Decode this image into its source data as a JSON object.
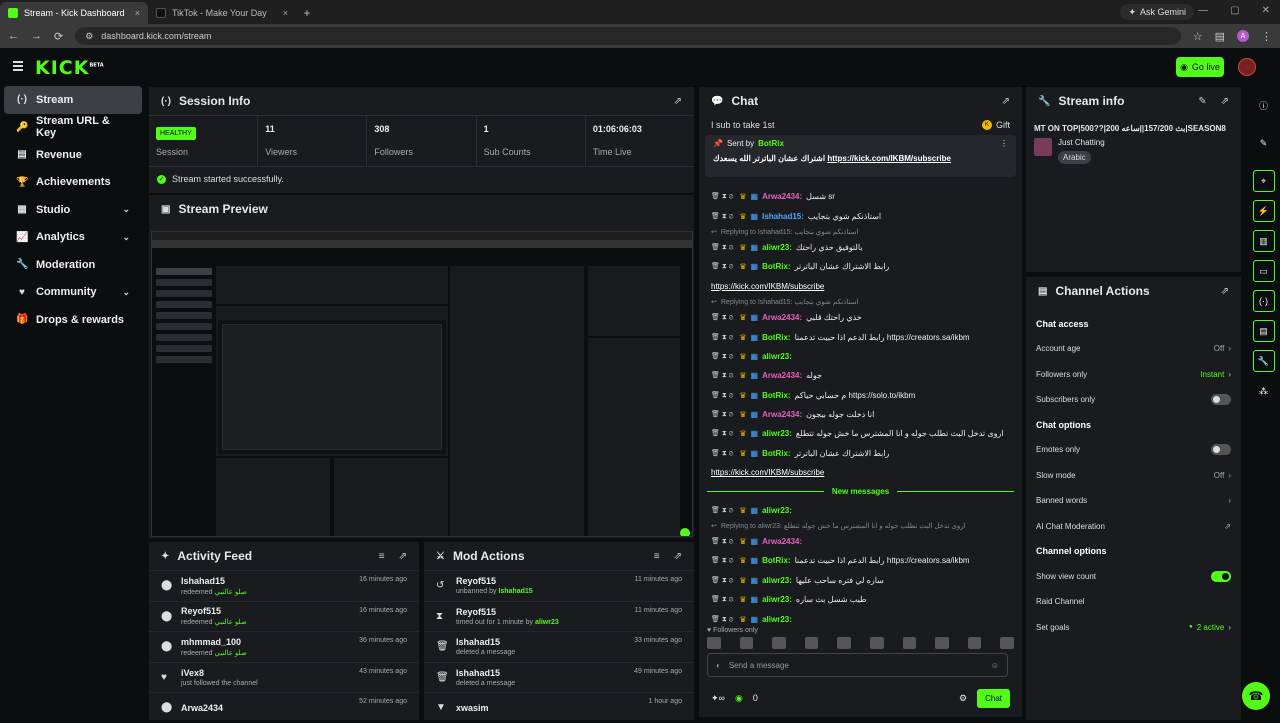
{
  "browser": {
    "tabs": [
      {
        "title": "Stream - Kick Dashboard"
      },
      {
        "title": "TikTok - Make Your Day"
      }
    ],
    "gemini": "Ask Gemini",
    "url": "dashboard.kick.com/stream",
    "profile_initial": "A"
  },
  "header": {
    "logo": "KICK",
    "logo_beta": "BETA",
    "go_live": "Go live"
  },
  "sidebar": {
    "items": [
      {
        "label": "Stream",
        "icon": "(·)"
      },
      {
        "label": "Stream URL & Key",
        "icon": "🔑"
      },
      {
        "label": "Revenue",
        "icon": "▤"
      },
      {
        "label": "Achievements",
        "icon": "🏆"
      },
      {
        "label": "Studio",
        "icon": "▦"
      },
      {
        "label": "Analytics",
        "icon": "📈"
      },
      {
        "label": "Moderation",
        "icon": "🔧"
      },
      {
        "label": "Community",
        "icon": "♥"
      },
      {
        "label": "Drops & rewards",
        "icon": "🎁"
      }
    ]
  },
  "session": {
    "title": "Session Info",
    "stats": [
      {
        "value": "HEALTHY",
        "label": "Session"
      },
      {
        "value": "11",
        "label": "Viewers"
      },
      {
        "value": "308",
        "label": "Followers"
      },
      {
        "value": "1",
        "label": "Sub Counts"
      },
      {
        "value": "01:06:06:03",
        "label": "Time Live"
      }
    ],
    "success": "Stream started successfully."
  },
  "preview": {
    "title": "Stream Preview"
  },
  "activity": {
    "title": "Activity Feed",
    "items": [
      {
        "name": "Ishahad15",
        "sub": "redeemed",
        "reward": "صلو عالنبي",
        "time": "16 minutes ago"
      },
      {
        "name": "Reyof515",
        "sub": "redeemed",
        "reward": "صلو عالنبي",
        "time": "16 minutes ago"
      },
      {
        "name": "mhmmad_100",
        "sub": "redeemed",
        "reward": "صلو عالنبي",
        "time": "36 minutes ago"
      },
      {
        "name": "iVex8",
        "sub": "just followed the channel",
        "reward": "",
        "time": "43 minutes ago"
      },
      {
        "name": "Arwa2434",
        "sub": "",
        "reward": "",
        "time": "52 minutes ago"
      }
    ]
  },
  "mod": {
    "title": "Mod Actions",
    "items": [
      {
        "icon": "↺",
        "name": "Reyof515",
        "sub": "unbanned by",
        "by": "Ishahad15",
        "time": "11 minutes ago"
      },
      {
        "icon": "⧗",
        "name": "Reyof515",
        "sub": "timed out for 1 minute by",
        "by": "aliwr23",
        "time": "11 minutes ago"
      },
      {
        "icon": "🗑",
        "name": "Ishahad15",
        "sub": "deleted a message",
        "by": "",
        "time": "33 minutes ago"
      },
      {
        "icon": "🗑",
        "name": "Ishahad15",
        "sub": "deleted a message",
        "by": "",
        "time": "49 minutes ago"
      },
      {
        "icon": "▼",
        "name": "xwasim",
        "sub": "",
        "by": "",
        "time": "1 hour ago"
      }
    ]
  },
  "chat": {
    "title": "Chat",
    "banner": "I sub to take 1st",
    "gift": "Gift",
    "pinned_sent_by": "Sent by",
    "pinned_user": "BotRix",
    "pinned_text": "اشتراك عشان الباترتر الله يسعدك",
    "pinned_link": "https://kick.com/IKBM/subscribe",
    "new_messages": "New messages",
    "followers_only": "Followers only",
    "placeholder": "Send a message",
    "count": "0",
    "send": "Chat",
    "lines": [
      {
        "type": "msg",
        "user": "Arwa2434:",
        "color": "pink",
        "text": "شسل sr"
      },
      {
        "type": "msg",
        "user": "Ishahad15:",
        "color": "blue",
        "text": "استاذنكم شوي بتجايب"
      },
      {
        "type": "reply",
        "text": "Replying to Ishahad15: استاذنكم شوي بتجايب"
      },
      {
        "type": "msg",
        "user": "aliwr23:",
        "color": "green",
        "text": "بالتوفيق حذي راحتك"
      },
      {
        "type": "msg",
        "user": "BotRix:",
        "color": "green",
        "text": "رابط الاشتراك عشان الباترتر"
      },
      {
        "type": "cont",
        "text": "https://kick.com/IKBM/subscribe"
      },
      {
        "type": "reply",
        "text": "Replying to Ishahad15: استاذنكم شوي بتجايب"
      },
      {
        "type": "msg",
        "user": "Arwa2434:",
        "color": "pink",
        "text": "خذي راحتك قلبي"
      },
      {
        "type": "msg",
        "user": "BotRix:",
        "color": "green",
        "text": "رابط الدعم اذا حبيت تدعمنا https://creators.sa/ikbm"
      },
      {
        "type": "msg",
        "user": "aliwr23:",
        "color": "green",
        "text": ""
      },
      {
        "type": "msg",
        "user": "Arwa2434:",
        "color": "pink",
        "text": "جوله"
      },
      {
        "type": "msg",
        "user": "BotRix:",
        "color": "green",
        "text": "م حسابي حياكم https://solo.to/ikbm"
      },
      {
        "type": "msg",
        "user": "Arwa2434:",
        "color": "pink",
        "text": "انا دخلت جوله بيجون"
      },
      {
        "type": "msg",
        "user": "aliwr23:",
        "color": "green",
        "text": "اروى تدخل البث تطلب جوله و انا المشترس ما خش جوله تتطلع"
      },
      {
        "type": "msg",
        "user": "BotRix:",
        "color": "green",
        "text": "رابط الاشتراك عشان الباترتر"
      },
      {
        "type": "cont",
        "text": "https://kick.com/IKBM/subscribe"
      },
      {
        "type": "new"
      },
      {
        "type": "msg",
        "user": "aliwr23:",
        "color": "green",
        "text": ""
      },
      {
        "type": "reply",
        "text": "Replying to aliwr23: اروى تدخل البث تطلب جوله و انا المشترس ما خش جوله تتطلع"
      },
      {
        "type": "msg",
        "user": "Arwa2434:",
        "color": "pink",
        "text": ""
      },
      {
        "type": "msg",
        "user": "BotRix:",
        "color": "green",
        "text": "رابط الدعم اذا حبيت تدعمنا https://creators.sa/ikbm"
      },
      {
        "type": "msg",
        "user": "aliwr23:",
        "color": "green",
        "text": "ساره لي فتره ساحب عليها"
      },
      {
        "type": "msg",
        "user": "aliwr23:",
        "color": "green",
        "text": "طيب شسل بث ساره"
      },
      {
        "type": "msg",
        "user": "aliwr23:",
        "color": "green",
        "text": ""
      }
    ]
  },
  "stream_info": {
    "title": "Stream info",
    "stream_title": "MT ON TOP|500??|200 بث 157/200||ساعه|SEASON8",
    "category": "Just Chatting",
    "language": "Arabic"
  },
  "channel_actions": {
    "title": "Channel Actions",
    "sections": [
      {
        "title": "Chat access",
        "rows": [
          {
            "label": "Account age",
            "value": "Off",
            "kind": "chev"
          },
          {
            "label": "Followers only",
            "value": "Instant",
            "kind": "chev-green"
          },
          {
            "label": "Subscribers only",
            "value": "",
            "kind": "toggle-off"
          }
        ]
      },
      {
        "title": "Chat options",
        "rows": [
          {
            "label": "Emotes only",
            "value": "",
            "kind": "toggle-off"
          },
          {
            "label": "Slow mode",
            "value": "Off",
            "kind": "chev"
          },
          {
            "label": "Banned words",
            "value": "",
            "kind": "chev"
          },
          {
            "label": "AI Chat Moderation",
            "value": "",
            "kind": "ext"
          }
        ]
      },
      {
        "title": "Channel options",
        "rows": [
          {
            "label": "Show view count",
            "value": "",
            "kind": "toggle-on"
          },
          {
            "label": "Raid Channel",
            "value": "",
            "kind": "none"
          },
          {
            "label": "Set goals",
            "value": "2 active",
            "kind": "chev-green"
          }
        ]
      }
    ]
  },
  "colors": {
    "accent": "#53fc18",
    "panel": "#191b1f",
    "bg": "#0b0e0f"
  }
}
